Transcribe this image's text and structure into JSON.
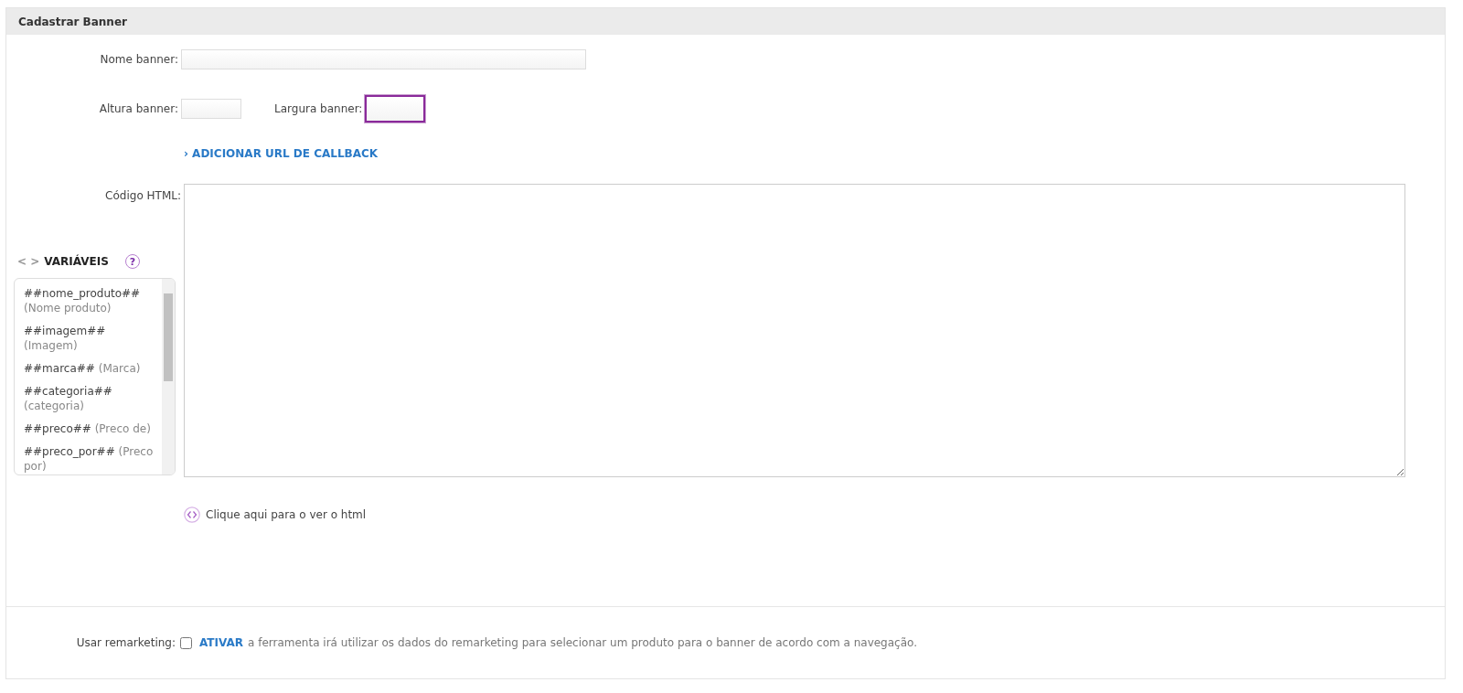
{
  "panel": {
    "title": "Cadastrar Banner"
  },
  "name_field": {
    "label": "Nome banner:",
    "focused": false
  },
  "height_field": {
    "label": "Altura banner:",
    "focused": false
  },
  "width_field": {
    "label": "Largura banner:",
    "focused": true
  },
  "callback_link": {
    "label": "› ADICIONAR URL DE CALLBACK"
  },
  "html_code": {
    "label": "Código HTML:"
  },
  "variables": {
    "title": "VARIÁVEIS",
    "icon_text": "< >",
    "help": "?",
    "items": [
      {
        "code": "##nome_produto##",
        "description": "(Nome produto)"
      },
      {
        "code": "##imagem##",
        "description": "(Imagem)"
      },
      {
        "code": "##marca##",
        "description": "(Marca)"
      },
      {
        "code": "##categoria##",
        "description": "(categoria)"
      },
      {
        "code": "##preco##",
        "description": "(Preco de)"
      },
      {
        "code": "##preco_por##",
        "description": "(Preco por)"
      }
    ]
  },
  "view_html_link": {
    "label": "Clique aqui para o ver o html"
  },
  "remarketing": {
    "label": "Usar remarketing:",
    "checked": false,
    "action": "ATIVAR",
    "description": "a ferramenta irá utilizar os dados do remarketing para selecionar um produto para o banner de acordo com a navegação."
  }
}
